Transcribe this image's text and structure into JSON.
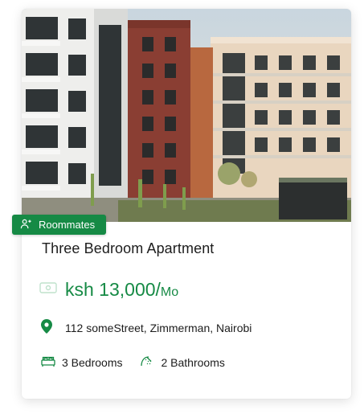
{
  "listing": {
    "badge_label": "Roommates",
    "title": "Three Bedroom Apartment",
    "price": "ksh 13,000/",
    "price_unit": "Mo",
    "address": "112 someStreet, Zimmerman, Nairobi",
    "bedrooms": "3 Bedrooms",
    "bathrooms": "2 Bathrooms"
  },
  "icons": {
    "badge": "roommates-icon",
    "price": "money-icon",
    "address": "location-pin-icon",
    "bedrooms": "bed-icon",
    "bathrooms": "shower-icon"
  },
  "colors": {
    "accent": "#168a45",
    "text": "#1d1d1d"
  }
}
